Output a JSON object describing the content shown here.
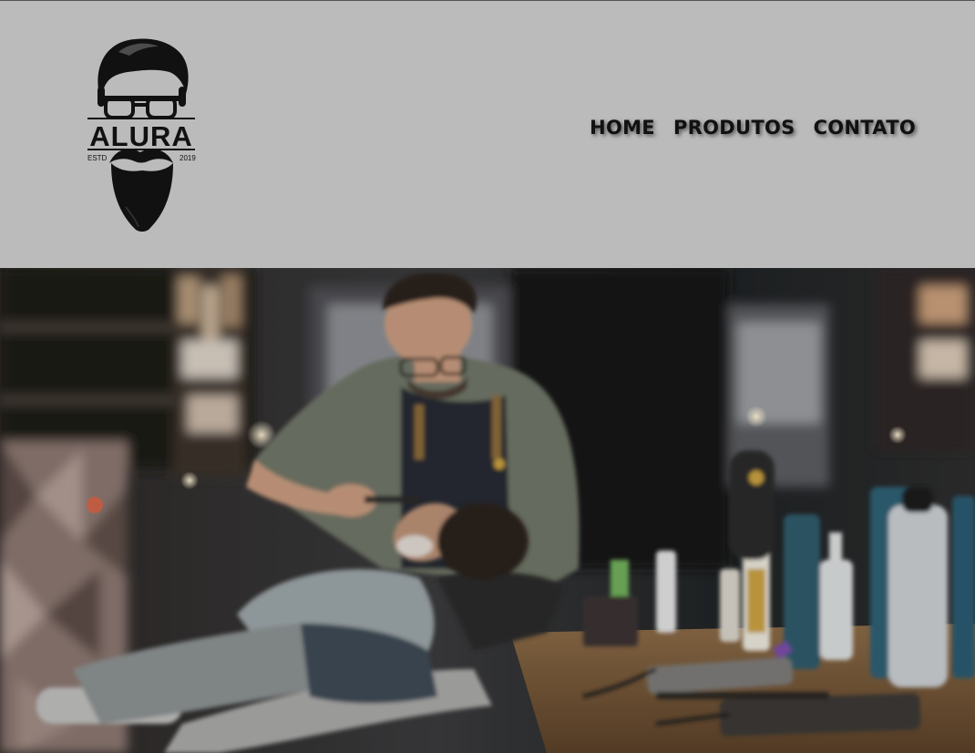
{
  "logo": {
    "brand": "ALURA",
    "left_tag": "ESTD",
    "right_tag": "2019"
  },
  "nav": {
    "items": [
      {
        "label": "HOME"
      },
      {
        "label": "PRODUTOS"
      },
      {
        "label": "CONTATO"
      }
    ]
  },
  "colors": {
    "header_bg": "#bbbbbb",
    "nav_text": "#111111",
    "logo": "#111111"
  }
}
